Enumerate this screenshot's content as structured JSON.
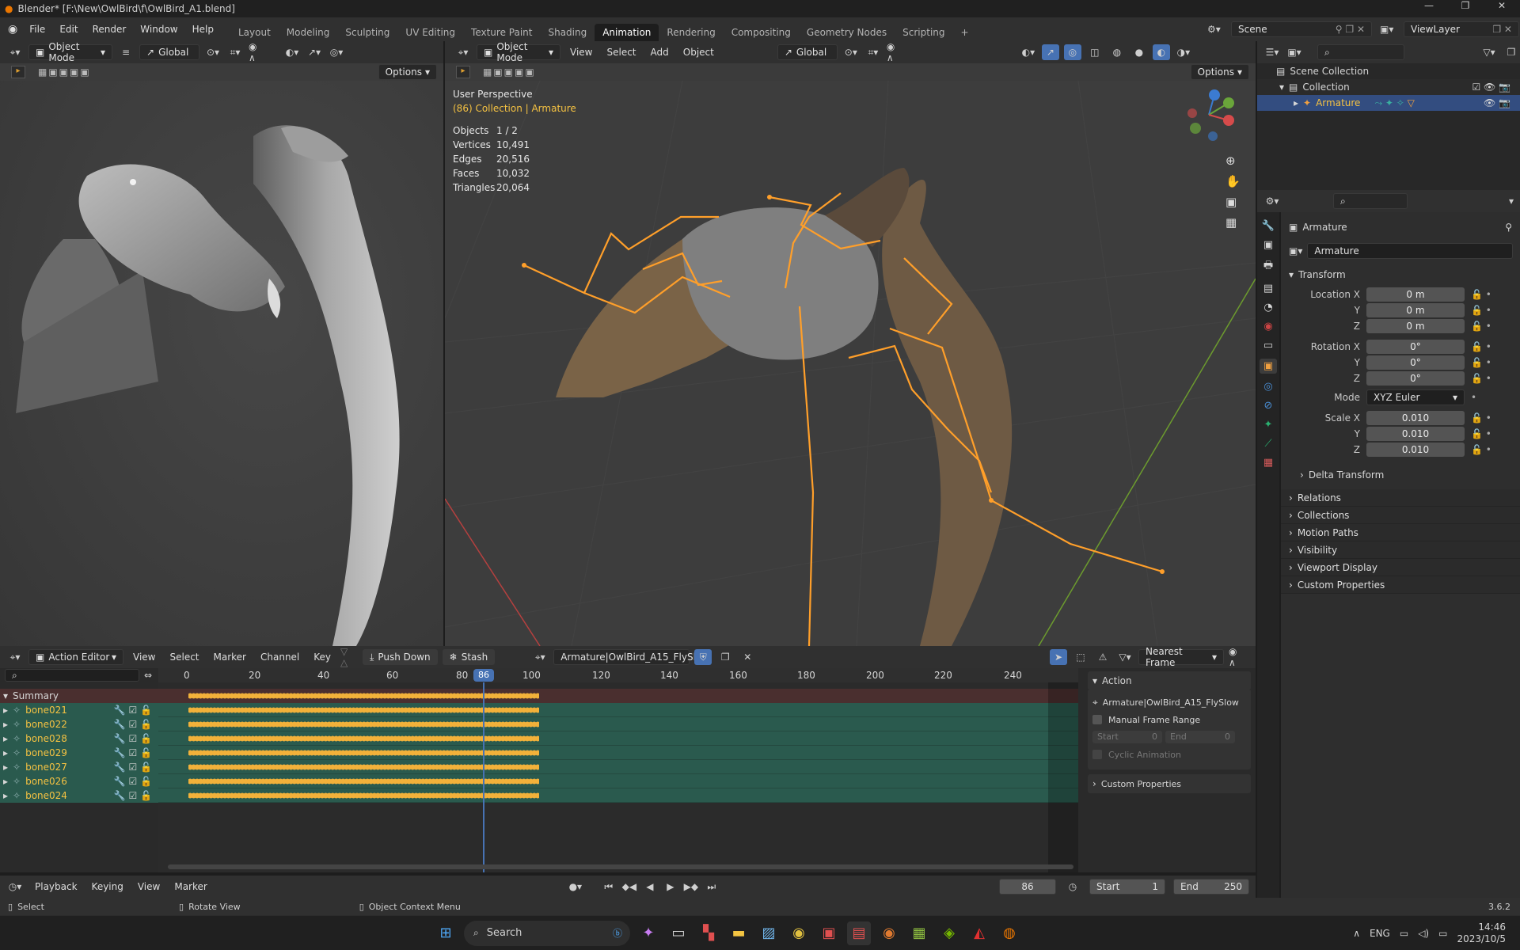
{
  "window_title": "Blender* [F:\\New\\OwlBird\\f\\OwlBird_A1.blend]",
  "menus": [
    "File",
    "Edit",
    "Render",
    "Window",
    "Help"
  ],
  "workspaces": [
    "Layout",
    "Modeling",
    "Sculpting",
    "UV Editing",
    "Texture Paint",
    "Shading",
    "Animation",
    "Rendering",
    "Compositing",
    "Geometry Nodes",
    "Scripting"
  ],
  "active_workspace": "Animation",
  "scene": "Scene",
  "view_layer": "ViewLayer",
  "left_viewport": {
    "mode": "Object Mode",
    "orientation": "Global",
    "options": "Options"
  },
  "main_viewport": {
    "mode": "Object Mode",
    "menus": [
      "View",
      "Select",
      "Add",
      "Object"
    ],
    "orientation": "Global",
    "options": "Options",
    "perspective": "User Perspective",
    "context": "(86) Collection | Armature",
    "stats": [
      {
        "label": "Objects",
        "value": "1 / 2"
      },
      {
        "label": "Vertices",
        "value": "10,491"
      },
      {
        "label": "Edges",
        "value": "20,516"
      },
      {
        "label": "Faces",
        "value": "10,032"
      },
      {
        "label": "Triangles",
        "value": "20,064"
      }
    ]
  },
  "outliner": {
    "root": "Scene Collection",
    "collection": "Collection",
    "object": "Armature"
  },
  "properties": {
    "object_name": "Armature",
    "object_field": "Armature",
    "transform_label": "Transform",
    "location": {
      "label": "Location X",
      "x": "0 m",
      "y": "0 m",
      "z": "0 m"
    },
    "rotation": {
      "label": "Rotation X",
      "x": "0°",
      "y": "0°",
      "z": "0°"
    },
    "mode_label": "Mode",
    "mode_value": "XYZ Euler",
    "scale": {
      "label": "Scale X",
      "x": "0.010",
      "y": "0.010",
      "z": "0.010"
    },
    "axis_y": "Y",
    "axis_z": "Z",
    "delta": "Delta Transform",
    "sections": [
      "Relations",
      "Collections",
      "Motion Paths",
      "Visibility",
      "Viewport Display",
      "Custom Properties"
    ]
  },
  "action_editor": {
    "editor": "Action Editor",
    "menus": [
      "View",
      "Select",
      "Marker",
      "Channel",
      "Key"
    ],
    "push_down": "Push Down",
    "stash": "Stash",
    "action": "Armature|OwlBird_A15_FlySlow",
    "snap": "Nearest Frame",
    "ruler": [
      "0",
      "20",
      "40",
      "60",
      "80",
      "100",
      "120",
      "140",
      "160",
      "180",
      "200",
      "220",
      "240"
    ],
    "current_frame": "86",
    "summary": "Summary",
    "channels": [
      "bone021",
      "bone022",
      "bone028",
      "bone029",
      "bone027",
      "bone026",
      "bone024"
    ],
    "panel": {
      "title": "Action",
      "action_name": "Armature|OwlBird_A15_FlySlow",
      "manual_range": "Manual Frame Range",
      "start_label": "Start",
      "start_value": "0",
      "end_label": "End",
      "end_value": "0",
      "cyclic": "Cyclic Animation",
      "custom_props": "Custom Properties"
    }
  },
  "timeline": {
    "menus": [
      "Playback",
      "Keying",
      "View",
      "Marker"
    ],
    "frame": "86",
    "start_label": "Start",
    "start": "1",
    "end_label": "End",
    "end": "250"
  },
  "status_bar": {
    "select": "Select",
    "rotate": "Rotate View",
    "context_menu": "Object Context Menu",
    "version": "3.6.2"
  },
  "taskbar": {
    "search": "Search",
    "lang": "ENG",
    "time": "14:46",
    "date": "2023/10/5"
  },
  "colors": {
    "accent": "#4772b3",
    "bone": "#ff9f2a",
    "keyframe": "#f2b13a",
    "channel_bg": "#2a5a4e",
    "summary_bg": "#4a2f2f"
  }
}
